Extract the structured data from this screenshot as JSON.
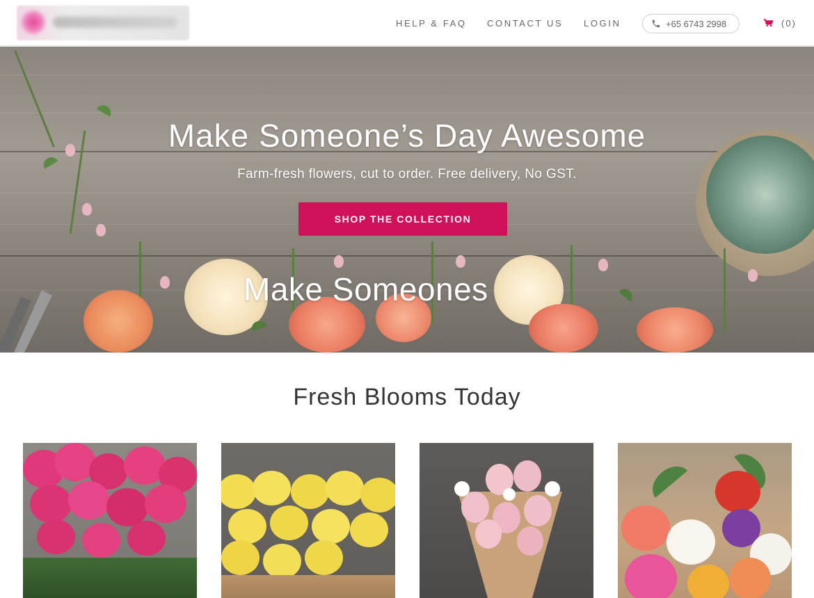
{
  "header": {
    "logo": "logo",
    "nav": {
      "help": "HELP & FAQ",
      "contact": "CONTACT US",
      "login": "LOGIN"
    },
    "phone": "+65 6743 2998",
    "cart_count": "(0)",
    "icons": {
      "phone": "phone-icon",
      "cart": "cart-icon"
    },
    "cart_color": "#d1105a"
  },
  "hero": {
    "title": "Make Someone’s Day Awesome",
    "subtitle": "Farm-fresh flowers, cut to order. Free delivery, No GST.",
    "cta_label": "SHOP THE COLLECTION",
    "overlay_text": "Make Someones",
    "accent": "#d1105a"
  },
  "section": {
    "title": "Fresh Blooms Today"
  },
  "products": [
    {
      "image": "pink-roses-bouquet"
    },
    {
      "image": "yellow-roses-bouquet"
    },
    {
      "image": "pink-tulips-white-flowers-wrap"
    },
    {
      "image": "mixed-ranunculus-bouquet"
    }
  ]
}
